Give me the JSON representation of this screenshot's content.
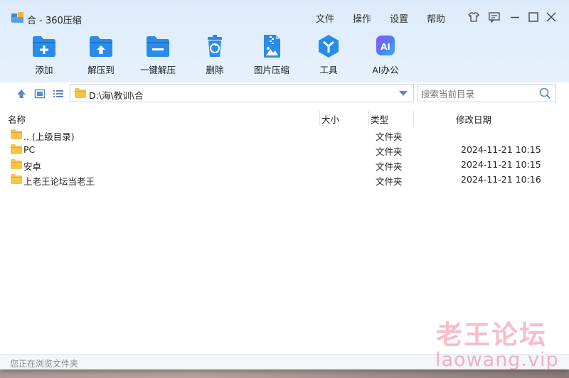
{
  "window": {
    "title": "合 - 360压缩",
    "menu": [
      "文件",
      "操作",
      "设置",
      "帮助"
    ],
    "controls": [
      "skin-icon",
      "feedback-icon",
      "minimize-icon",
      "maximize-icon",
      "close-icon"
    ]
  },
  "toolbar": {
    "buttons": [
      {
        "label": "添加",
        "icon": "add-icon"
      },
      {
        "label": "解压到",
        "icon": "extract-to-icon"
      },
      {
        "label": "一键解压",
        "icon": "one-click-extract-icon"
      },
      {
        "label": "删除",
        "icon": "delete-icon"
      },
      {
        "label": "图片压缩",
        "icon": "image-compress-icon"
      },
      {
        "label": "工具",
        "icon": "tools-icon"
      },
      {
        "label": "AI办公",
        "icon": "ai-office-icon"
      }
    ],
    "ai_badge": "AI"
  },
  "address": {
    "path": "D:\\海\\教训\\合",
    "search_placeholder": "搜索当前目录"
  },
  "columns": {
    "name": "名称",
    "size": "大小",
    "type": "类型",
    "date": "修改日期"
  },
  "files": [
    {
      "name": ".. (上级目录)",
      "type": "文件夹",
      "date": ""
    },
    {
      "name": "PC",
      "type": "文件夹",
      "date": "2024-11-21 10:15"
    },
    {
      "name": "安卓",
      "type": "文件夹",
      "date": "2024-11-21 10:15"
    },
    {
      "name": "上老王论坛当老王",
      "type": "文件夹",
      "date": "2024-11-21 10:16"
    }
  ],
  "status": {
    "text": "您正在浏览文件夹"
  },
  "watermark": {
    "line1": "老王论坛",
    "line2": "laowang.vip"
  },
  "colors": {
    "accent_blue": "#2a8ce8",
    "folder_yellow": "#f7c34a",
    "header_bg": "#dcebfb",
    "ai_gradient_start": "#8e55f5",
    "ai_gradient_end": "#2bb6f0"
  }
}
